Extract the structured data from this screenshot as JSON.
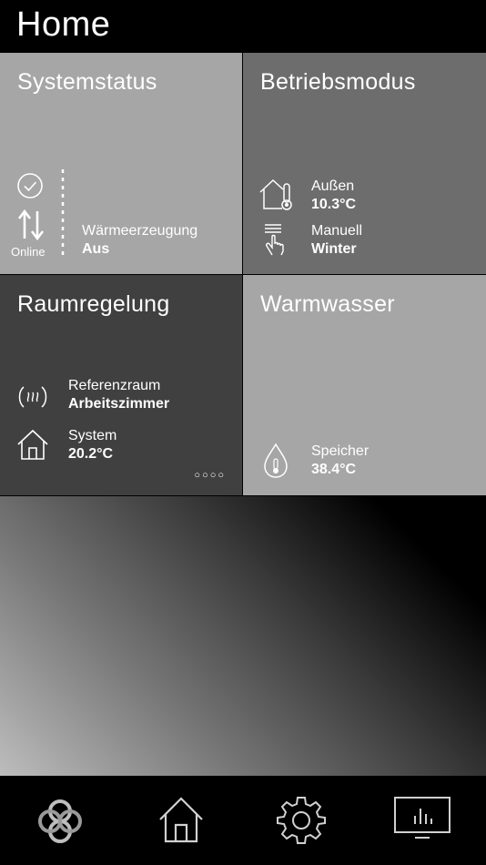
{
  "header": {
    "title": "Home"
  },
  "tiles": {
    "systemstatus": {
      "title": "Systemstatus",
      "online_label": "Online",
      "heat_label": "Wärmeerzeugung",
      "heat_value": "Aus"
    },
    "betriebsmodus": {
      "title": "Betriebsmodus",
      "outside_label": "Außen",
      "outside_value": "10.3°C",
      "mode_label": "Manuell",
      "mode_value": "Winter"
    },
    "raumregelung": {
      "title": "Raumregelung",
      "ref_label": "Referenzraum",
      "ref_value": "Arbeitszimmer",
      "system_label": "System",
      "system_value": "20.2°C",
      "pager": "○○○○"
    },
    "warmwasser": {
      "title": "Warmwasser",
      "storage_label": "Speicher",
      "storage_value": "38.4°C"
    }
  },
  "nav": {
    "items": [
      "logo-knot-icon",
      "home-icon",
      "settings-gear-icon",
      "stats-monitor-icon"
    ]
  }
}
